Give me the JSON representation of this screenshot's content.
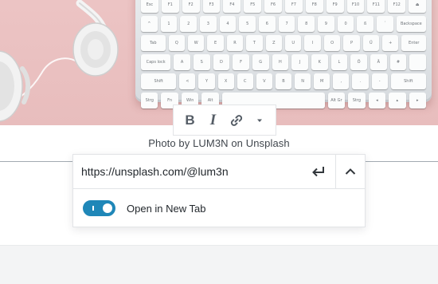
{
  "image": {
    "alt": "Keyboard and headphones on pink background",
    "bg_color": "#e9c0c0",
    "keyboard_rows": [
      [
        "Esc",
        "F1",
        "F2",
        "F3",
        "F4",
        "F5",
        "F6",
        "F7",
        "F8",
        "F9",
        "F10",
        "F11",
        "F12",
        "⏏"
      ],
      [
        "^",
        "1",
        "2",
        "3",
        "4",
        "5",
        "6",
        "7",
        "8",
        "9",
        "0",
        "ß",
        "´",
        "Backspace"
      ],
      [
        "Tab",
        "Q",
        "W",
        "E",
        "R",
        "T",
        "Z",
        "U",
        "I",
        "O",
        "P",
        "Ü",
        "+",
        "Enter"
      ],
      [
        "Caps lock",
        "A",
        "S",
        "D",
        "F",
        "G",
        "H",
        "J",
        "K",
        "L",
        "Ö",
        "Ä",
        "#",
        ""
      ],
      [
        "Shift",
        "<",
        "Y",
        "X",
        "C",
        "V",
        "B",
        "N",
        "M",
        ",",
        ".",
        "-",
        "Shift"
      ],
      [
        "Strg",
        "Fn",
        "Win",
        "Alt",
        "",
        "Alt Gr",
        "Strg",
        "◂",
        "▴",
        "▸"
      ]
    ]
  },
  "toolbar": {
    "bold_label": "B",
    "italic_label": "I",
    "link_icon": "link-icon",
    "more_icon": "caret-down-icon"
  },
  "caption": {
    "text": "Photo by LUM3N on Unsplash"
  },
  "link_popover": {
    "url_value": "https://unsplash.com/@lum3n",
    "submit_icon": "enter-arrow-icon",
    "expand_icon": "chevron-up-icon",
    "new_tab_label": "Open in New Tab",
    "new_tab_enabled": true,
    "toggle_color": "#1f87b8"
  }
}
